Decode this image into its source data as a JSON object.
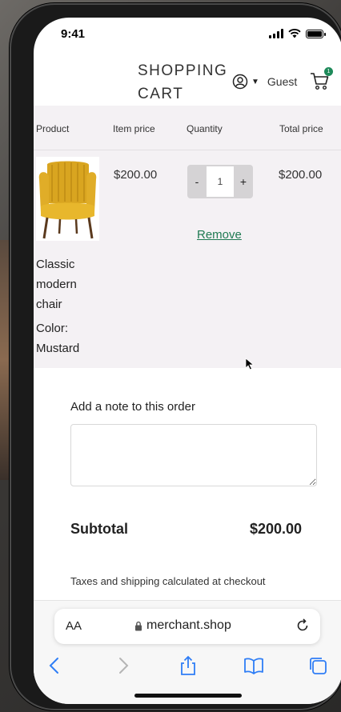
{
  "status_bar": {
    "time": "9:41"
  },
  "header": {
    "title": "SHOPPING CART",
    "account_label": "Guest",
    "cart_count": "1"
  },
  "table": {
    "columns": [
      "Product",
      "Item price",
      "Quantity",
      "Total price"
    ],
    "items": [
      {
        "name": "Classic modern chair",
        "color_label": "Color:",
        "color_value": "Mustard",
        "item_price": "$200.00",
        "quantity": "1",
        "decrement": "-",
        "increment": "+",
        "total_price": "$200.00",
        "remove_label": "Remove",
        "image_color": "#d9a520"
      }
    ]
  },
  "note": {
    "label": "Add a note to this order",
    "value": ""
  },
  "summary": {
    "subtotal_label": "Subtotal",
    "subtotal_value": "$200.00",
    "tax_note": "Taxes and shipping calculated at checkout"
  },
  "browser": {
    "text_size_label": "AA",
    "url": "merchant.shop"
  },
  "colors": {
    "accent": "#1f7a52",
    "badge": "#1e8a5a",
    "safari_blue": "#2f7ef6"
  }
}
